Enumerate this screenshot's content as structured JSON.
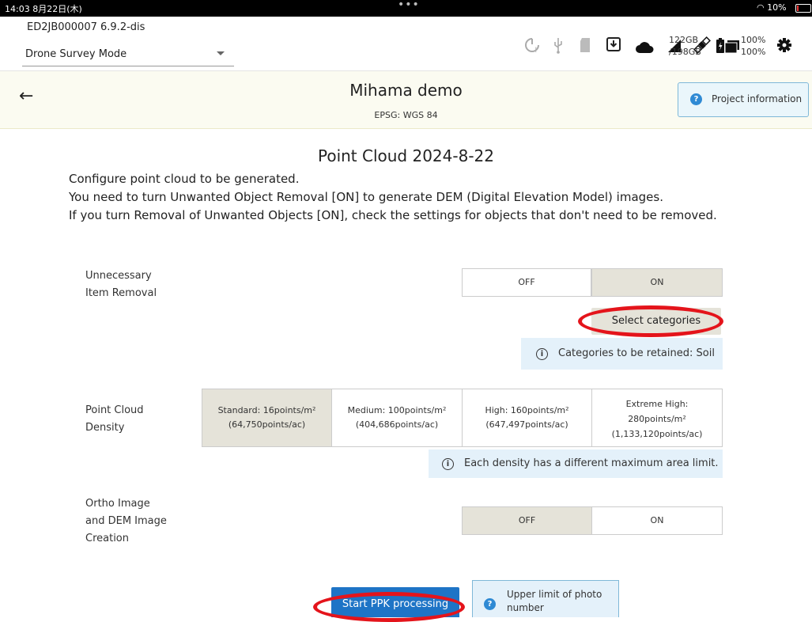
{
  "status_bar": {
    "time": "14:03  8月22日(木)",
    "dots": "•••",
    "wifi": "10%"
  },
  "device": {
    "id": "ED2JB000007    6.9.2-dis",
    "mode": "Drone Survey Mode",
    "storage": "122GB",
    "storage_total": "/198GB",
    "battery_1": "100%",
    "battery_2": "100%",
    "icons": [
      "signal-icon",
      "usb-icon",
      "sd-card-icon",
      "download-icon",
      "cloud-icon",
      "cellular-icon",
      "satellite-icon",
      "folder-icon",
      "battery-icon",
      "gear-icon"
    ]
  },
  "project": {
    "back": "←",
    "title": "Mihama demo",
    "epsg": "EPSG: WGS 84",
    "info_button": "Project information"
  },
  "main": {
    "title": "Point Cloud 2024-8-22",
    "description": [
      "Configure point cloud to be generated.",
      "You need to turn Unwanted Object Removal [ON] to generate DEM (Digital Elevation Model) images.",
      "If you turn Removal of Unwanted Objects [ON], check the settings for objects that don't need to be removed."
    ],
    "removal": {
      "label": [
        "Unnecessary",
        "Item Removal"
      ],
      "off": "OFF",
      "on": "ON",
      "selected": "ON",
      "select_categories": "Select categories",
      "retained": "Categories to be retained: Soil"
    },
    "density": {
      "label": [
        "Point Cloud",
        "Density"
      ],
      "options": [
        {
          "line1": "Standard: 16points/m²",
          "line2": "(64,750points/ac)",
          "line3": ""
        },
        {
          "line1": "Medium: 100points/m²",
          "line2": "(404,686points/ac)",
          "line3": ""
        },
        {
          "line1": "High: 160points/m²",
          "line2": "(647,497points/ac)",
          "line3": ""
        },
        {
          "line1": "Extreme High:",
          "line2": "280points/m²",
          "line3": "(1,133,120points/ac)"
        }
      ],
      "selected": "Standard: 16points/m²",
      "note": "Each density has a different maximum area limit."
    },
    "ortho": {
      "label": [
        "Ortho Image",
        "and DEM Image",
        "Creation"
      ],
      "off": "OFF",
      "on": "ON",
      "selected": "OFF"
    },
    "start_button": "Start PPK processing",
    "upper_limit": "Upper limit of photo number"
  },
  "colors": {
    "accent": "#1e74c6",
    "selected_segment": "#e5e3d9",
    "info_bg": "#e4f1fa",
    "annotation_ring": "#e4141b"
  }
}
